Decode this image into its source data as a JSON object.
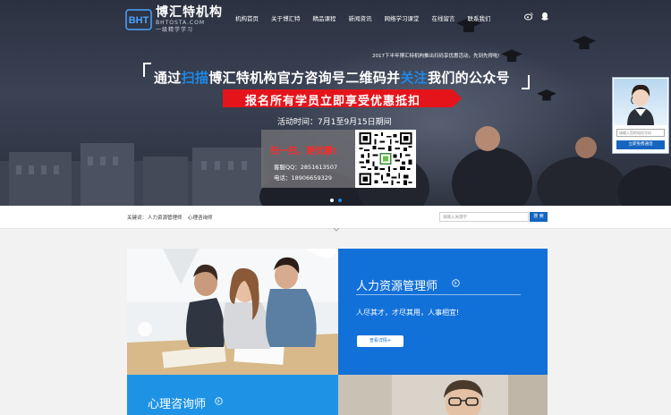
{
  "header": {
    "logo_name": "博汇特机构",
    "logo_sub": "一级精学学习",
    "logo_domain": "BHTOSTA.COM",
    "nav": [
      "机构首页",
      "关于博汇特",
      "精品课程",
      "新闻资讯",
      "网络学习课堂",
      "在线留言",
      "联系我们"
    ],
    "social_icons": [
      "weibo-icon",
      "qq-icon"
    ]
  },
  "banner": {
    "promo_top": "2017下半年博汇特机构推出扫码享优惠活动，先到先得啦!",
    "headline_part1": "通过",
    "headline_hl1": "扫描",
    "headline_part2": "博汇特机构官方咨询号二维码并",
    "headline_hl2": "关注",
    "headline_part3": "我们的公众号",
    "red_bar": "报名所有学员立即享受优惠抵扣",
    "event_time": "活动时间：7月1至9月15日期间",
    "scan_label": "扫一扫，更优惠!",
    "qq": "客服QQ：2851613507",
    "phone": "电话：18906659329",
    "slide_dots": 2,
    "active_dot": 1,
    "accent_color": "#1e88e5",
    "promo_color": "#e5141b"
  },
  "service_widget": {
    "input_placeholder": "请输入您的电话号码",
    "button": "立即免费通话"
  },
  "keyword_bar": {
    "label": "关键词：",
    "keywords": [
      "人力资源管理师",
      "心理咨询师"
    ],
    "search_placeholder": "请输入关键字",
    "search_button": "搜 索"
  },
  "courses": [
    {
      "title": "人力资源管理师",
      "desc": "人尽其才，才尽其用，人事相宜!",
      "button": "查看详情+"
    },
    {
      "title": "心理咨询师"
    }
  ]
}
